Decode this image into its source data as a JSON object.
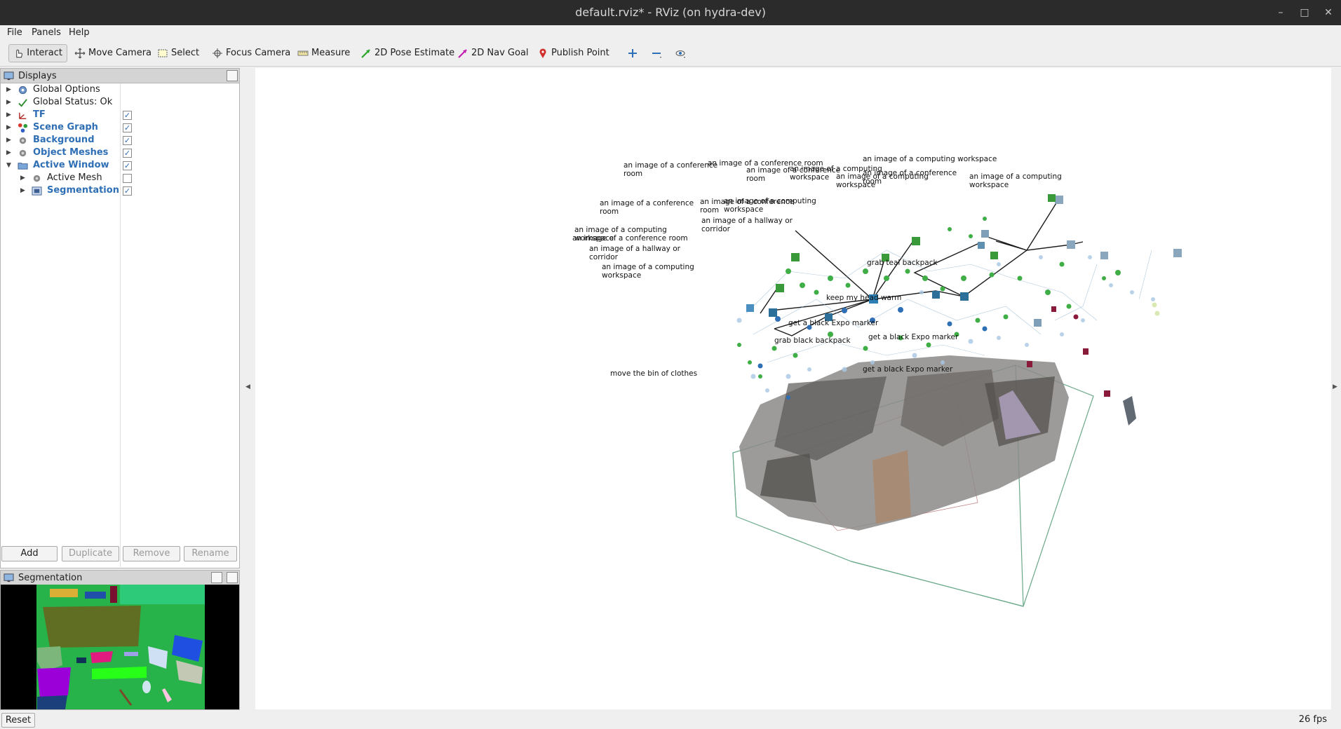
{
  "window": {
    "title": "default.rviz* - RViz (on hydra-dev)",
    "minimize": "–",
    "maximize": "□",
    "close": "✕"
  },
  "menu": [
    "File",
    "Panels",
    "Help"
  ],
  "toolbar": {
    "interact": "Interact",
    "move_camera": "Move Camera",
    "select": "Select",
    "focus_camera": "Focus Camera",
    "measure": "Measure",
    "pose_estimate": "2D Pose Estimate",
    "nav_goal": "2D Nav Goal",
    "publish_point": "Publish Point"
  },
  "displays": {
    "title": "Displays",
    "items": [
      {
        "label": "Global Options",
        "icon": "gear-icon",
        "checked": null
      },
      {
        "label": "Global Status: Ok",
        "icon": "check-icon",
        "checked": null
      },
      {
        "label": "TF",
        "icon": "tf-icon",
        "checked": true
      },
      {
        "label": "Scene Graph",
        "icon": "scene-graph-icon",
        "checked": true
      },
      {
        "label": "Background",
        "icon": "background-icon",
        "checked": true
      },
      {
        "label": "Object Meshes",
        "icon": "mesh-icon",
        "checked": true
      },
      {
        "label": "Active Window",
        "icon": "folder-icon",
        "checked": true
      },
      {
        "label": "Active Mesh",
        "icon": "mesh-icon",
        "checked": false
      },
      {
        "label": "Segmentation",
        "icon": "image-icon",
        "checked": true
      }
    ],
    "buttons": {
      "add": "Add",
      "duplicate": "Duplicate",
      "remove": "Remove",
      "rename": "Rename"
    }
  },
  "segmentation_panel": {
    "title": "Segmentation"
  },
  "viewport_labels": [
    "an image of a computing workspace",
    "an image of a conference room",
    "an image of a conference room",
    "an image of a computing workspace",
    "an image of a conference room",
    "an image of a computing workspace",
    "an image of a conference room",
    "an image of a computing workspace",
    "an image of a conference room",
    "an image of a computing workspace",
    "an image of a conference room",
    "an image of a hallway or corridor",
    "an image of a computing workspace",
    "an image of a conference room",
    "an image of a hallway or corridor",
    "an image of a computing workspace",
    "grab teal backpack",
    "get a black Expo marker",
    "grab black backpack",
    "get a black Expo marker",
    "move the bin of clothes",
    "keep my head warm",
    "get a black Expo marker"
  ],
  "status": {
    "reset": "Reset",
    "fps": "26 fps"
  }
}
